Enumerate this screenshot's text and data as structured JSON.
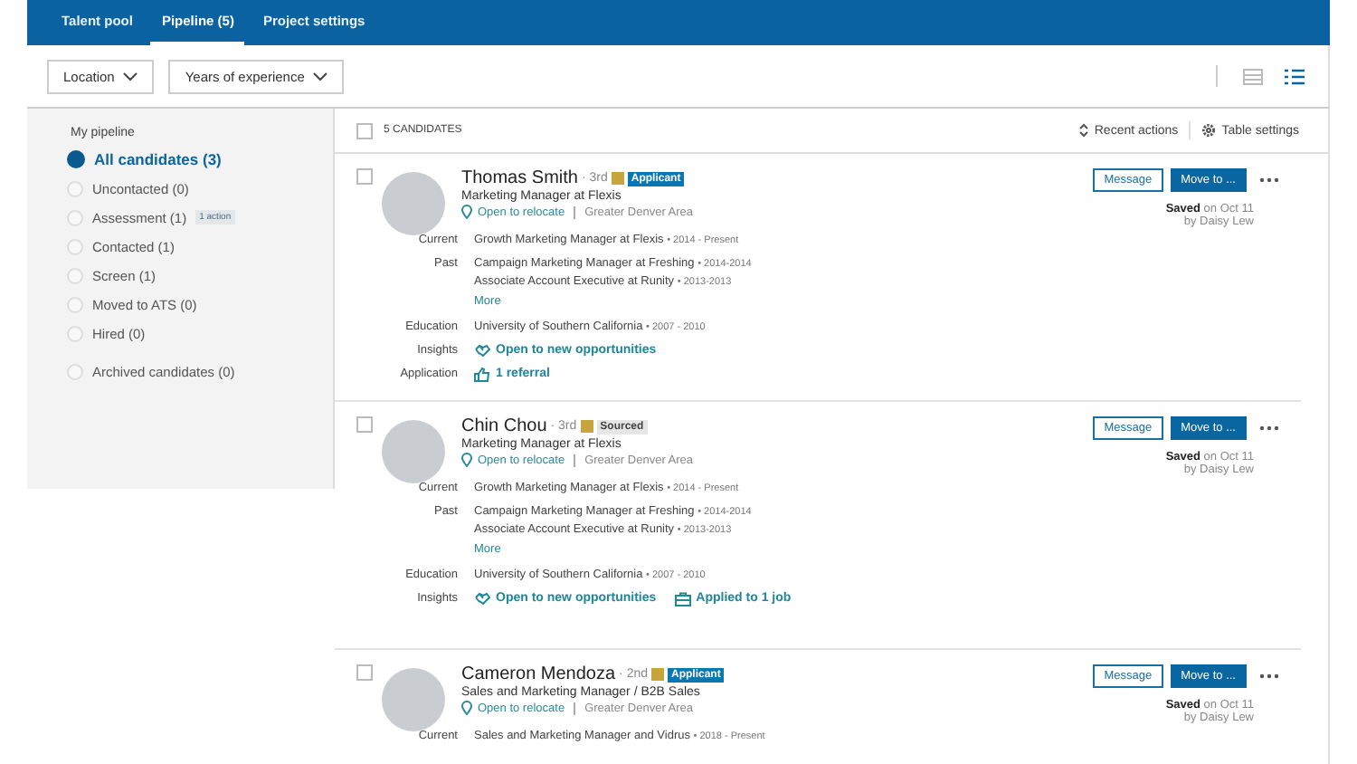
{
  "tabs": [
    {
      "label": "Talent pool",
      "selected": false
    },
    {
      "label": "Pipeline (5)",
      "selected": true
    },
    {
      "label": "Project settings",
      "selected": false
    }
  ],
  "filters": [
    "Location",
    "Years of experience"
  ],
  "view_toggle": [
    {
      "kind": "grid",
      "selected": false
    },
    {
      "kind": "list",
      "selected": true
    }
  ],
  "sidebar": {
    "heading": "My pipeline",
    "items": [
      {
        "kind": "total",
        "label": "All candidates (3)",
        "selected": true
      },
      {
        "kind": "stage",
        "label": "Uncontacted (0)",
        "selected": false
      },
      {
        "kind": "stage",
        "label": "Assessment (1)",
        "badge": "1 action",
        "selected": false
      },
      {
        "kind": "stage",
        "label": "Contacted (1)",
        "selected": false
      },
      {
        "kind": "stage",
        "label": "Screen (1)",
        "selected": false
      },
      {
        "kind": "stage",
        "label": "Moved to ATS (0)",
        "selected": false
      },
      {
        "kind": "stage",
        "label": "Hired (0)",
        "selected": false
      },
      {
        "kind": "archived",
        "label": "Archived candidates (0)",
        "selected": false
      }
    ]
  },
  "list_header": {
    "select_all_checked": false,
    "count": "5 CANDIDATES",
    "actions": [
      {
        "kind": "sort",
        "label": "Recent actions"
      },
      {
        "kind": "settings",
        "label": "Table settings"
      }
    ]
  },
  "candidates": [
    {
      "name": "Thomas Smith",
      "degree": "· 3rd",
      "badge": {
        "label": "Applicant",
        "kind": "applicant"
      },
      "headline": "Marketing Manager at Flexis",
      "relocate": "Open to relocate",
      "location": "Greater Denver Area",
      "checked": false,
      "rows": [
        {
          "label": "Current",
          "kind": "entries",
          "items": [
            {
              "text": "Growth Marketing Manager at Flexis",
              "dates": "• 2014 - Present"
            }
          ]
        },
        {
          "label": "Past",
          "kind": "entries",
          "items": [
            {
              "text": "Campaign Marketing Manager at Freshing",
              "dates": "• 2014-2014"
            },
            {
              "text": "Associate Account Executive at Runity",
              "dates": "• 2013-2013"
            }
          ],
          "more": "More"
        },
        {
          "label": "Education",
          "kind": "entries",
          "items": [
            {
              "text": "University of Southern California",
              "dates": "• 2007 - 2010"
            }
          ]
        },
        {
          "label": "Insights",
          "kind": "links",
          "items": [
            {
              "kind": "opportunity",
              "text": "Open to new opportunities"
            }
          ]
        },
        {
          "label": "Application",
          "kind": "links",
          "items": [
            {
              "kind": "referral",
              "text": "1 referral"
            }
          ]
        }
      ],
      "buttons": [
        "Message",
        "Move to ..."
      ],
      "saved": "Saved",
      "saved_on": "on Oct 11",
      "saved_by": "by Daisy Lew"
    },
    {
      "name": "Chin Chou",
      "degree": "· 3rd",
      "badge": {
        "label": "Sourced",
        "kind": "sourced"
      },
      "headline": "Marketing Manager at Flexis",
      "relocate": "Open to relocate",
      "location": "Greater Denver Area",
      "checked": false,
      "rows": [
        {
          "label": "Current",
          "kind": "entries",
          "items": [
            {
              "text": "Growth Marketing Manager at Flexis",
              "dates": "• 2014 - Present"
            }
          ]
        },
        {
          "label": "Past",
          "kind": "entries",
          "items": [
            {
              "text": "Campaign Marketing Manager at Freshing",
              "dates": "• 2014-2014"
            },
            {
              "text": "Associate Account Executive at Runity",
              "dates": "• 2013-2013"
            }
          ],
          "more": "More"
        },
        {
          "label": "Education",
          "kind": "entries",
          "items": [
            {
              "text": "University of Southern California",
              "dates": "• 2007 - 2010"
            }
          ]
        },
        {
          "label": "Insights",
          "kind": "links",
          "items": [
            {
              "kind": "opportunity",
              "text": "Open to new opportunities"
            },
            {
              "kind": "job",
              "text": "Applied to 1 job"
            }
          ]
        }
      ],
      "buttons": [
        "Message",
        "Move to ..."
      ],
      "saved": "Saved",
      "saved_on": "on Oct 11",
      "saved_by": "by Daisy Lew"
    },
    {
      "name": "Cameron Mendoza",
      "degree": "· 2nd",
      "badge": {
        "label": "Applicant",
        "kind": "applicant"
      },
      "headline": "Sales and Marketing Manager / B2B Sales",
      "relocate": "Open to relocate",
      "location": "Greater Denver Area",
      "checked": false,
      "rows": [
        {
          "label": "Current",
          "kind": "entries",
          "items": [
            {
              "text": "Sales and Marketing Manager and Vidrus",
              "dates": "• 2018 - Present"
            }
          ]
        }
      ],
      "buttons": [
        "Message",
        "Move to ..."
      ],
      "saved": "Saved",
      "saved_on": "on Oct 11",
      "saved_by": "by Daisy Lew"
    }
  ]
}
